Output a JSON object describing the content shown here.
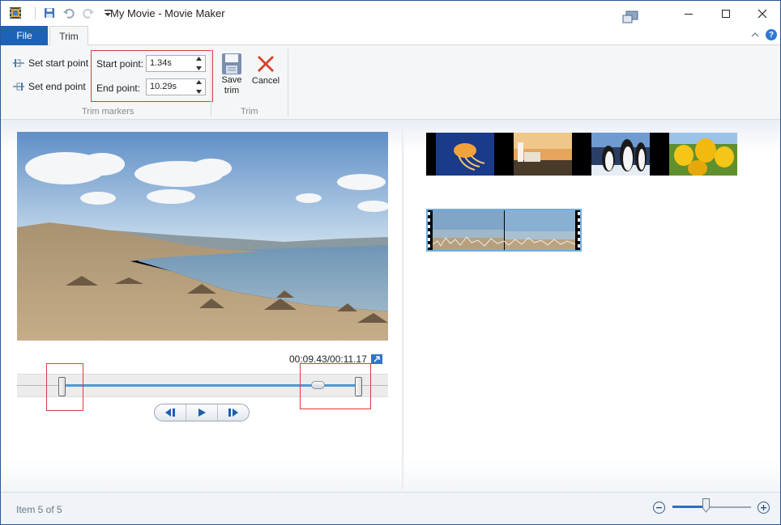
{
  "window": {
    "title": "My Movie - Movie Maker",
    "accent_color": "#1e62b5"
  },
  "quick_access": {
    "icons": [
      "film-icon",
      "save-icon",
      "undo-icon",
      "redo-icon",
      "customize-dropdown-icon"
    ]
  },
  "ribbon": {
    "tabs": [
      {
        "label": "File",
        "active": false
      },
      {
        "label": "Trim",
        "active": true
      }
    ],
    "trim_markers": {
      "set_start_label": "Set start point",
      "set_end_label": "Set end point",
      "start_point_label": "Start point:",
      "start_point_value": "1.34s",
      "end_point_label": "End point:",
      "end_point_value": "10.29s",
      "group_label": "Trim markers"
    },
    "trim": {
      "save_label_line1": "Save",
      "save_label_line2": "trim",
      "cancel_label": "Cancel",
      "group_label": "Trim"
    },
    "help_label": "?"
  },
  "preview": {
    "timecode": "00:09.43/00:11.17",
    "trim_start_fraction": 0.12,
    "trim_end_fraction": 0.92,
    "playhead_fraction": 0.81
  },
  "storyboard": {
    "clips": [
      "jellyfish",
      "lighthouse",
      "penguins",
      "tulips",
      "beach video"
    ],
    "selected_clip": 5
  },
  "status": {
    "item_text": "Item 5 of 5",
    "zoom_level_fraction": 0.42
  }
}
